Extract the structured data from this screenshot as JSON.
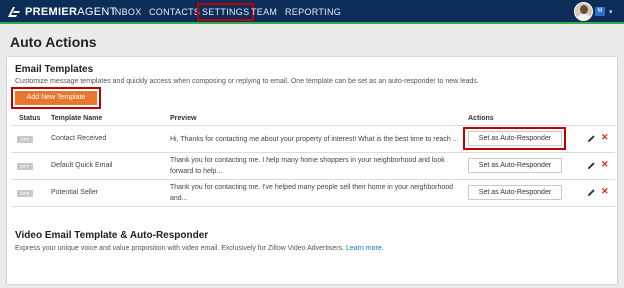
{
  "brand": {
    "name_bold": "PREMIER",
    "name_thin": "AGENT"
  },
  "nav": {
    "inbox": "INBOX",
    "contacts": "CONTACTS",
    "settings": "SETTINGS",
    "team": "TEAM",
    "reporting": "REPORTING"
  },
  "header": {
    "notification_badge": "M",
    "caret": "▾"
  },
  "page": {
    "title": "Auto Actions"
  },
  "email_templates": {
    "title": "Email Templates",
    "description": "Customize message templates and quickly access when composing or replying to email. One template can be set as an auto-responder to new leads.",
    "add_button": "Add New Template",
    "columns": {
      "status": "Status",
      "name": "Template Name",
      "preview": "Preview",
      "actions": "Actions"
    },
    "rows": [
      {
        "status": "OFF",
        "name": "Contact Received",
        "preview_line1": "Hi,   Thanks for contacting me about your property of interest! What is the best time to reach ...",
        "preview_line2": "",
        "action": "Set as Auto-Responder"
      },
      {
        "status": "OFF",
        "name": "Default Quick Email",
        "preview_line1": "Thank you for contacting me. I help many home shoppers in your neighborhood and look",
        "preview_line2": "forward to help...",
        "action": "Set as Auto-Responder"
      },
      {
        "status": "OFF",
        "name": "Potential Seller",
        "preview_line1": " Thank you for contacting me. I've helped many people sell their home in your neighborhood",
        "preview_line2": "and...",
        "action": "Set as Auto-Responder"
      }
    ]
  },
  "video": {
    "title": "Video Email Template & Auto-Responder",
    "description": "Express your unique voice and value proposition with video email. Exclusively for Zillow Video Advertisers.",
    "learn_more": "Learn more."
  },
  "colors": {
    "nav_bg": "#0c2d57",
    "accent_green": "#34a853",
    "add_button": "#e8772e",
    "highlight": "#c00000",
    "delete": "#d0311e",
    "link": "#1a6fc9"
  },
  "icons": [
    "premier-agent-logo-icon",
    "edit-pencil-icon",
    "delete-x-icon",
    "avatar",
    "chevron-down-icon"
  ]
}
